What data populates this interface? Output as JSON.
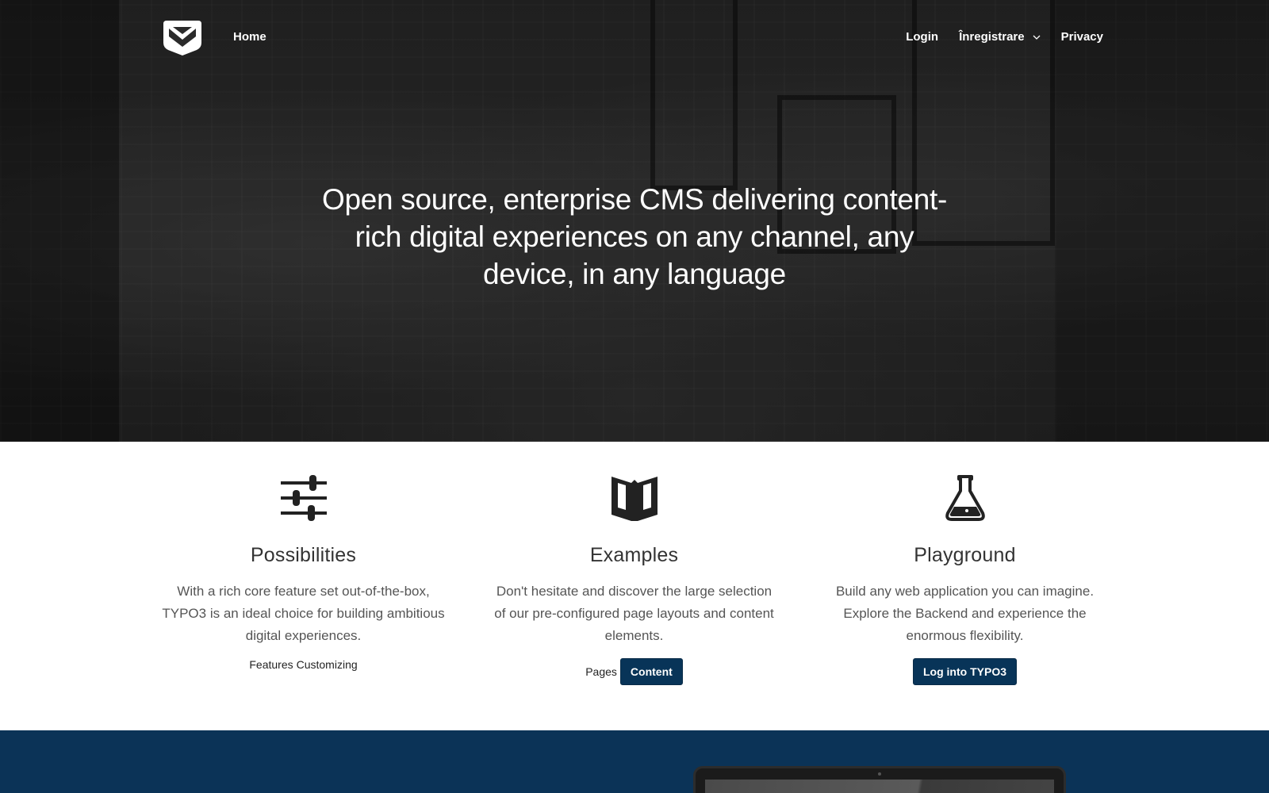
{
  "nav": {
    "home": "Home",
    "login": "Login",
    "register": "Înregistrare",
    "privacy": "Privacy"
  },
  "hero": {
    "title": "Open source, enterprise CMS delivering content-rich digital experiences on any channel, any device, in any language"
  },
  "features": [
    {
      "icon": "sliders-icon",
      "title": "Possibilities",
      "text": "With a rich core feature set out-of-the-box, TYPO3 is an ideal choice for building ambitious digital experiences.",
      "links": [
        "Features",
        "Customizing"
      ]
    },
    {
      "icon": "book-icon",
      "title": "Examples",
      "text": "Don't hesitate and discover the large selection of our pre-configured page layouts and content elements.",
      "link": "Pages",
      "button": "Content"
    },
    {
      "icon": "flask-icon",
      "title": "Playground",
      "text": "Build any web application you can imagine. Explore the Backend and experience the enormous flexibility.",
      "button": "Log into TYPO3"
    }
  ],
  "colors": {
    "accent": "#083458",
    "footer": "#0b3357",
    "hero_overlay": "#2a2a2a"
  }
}
